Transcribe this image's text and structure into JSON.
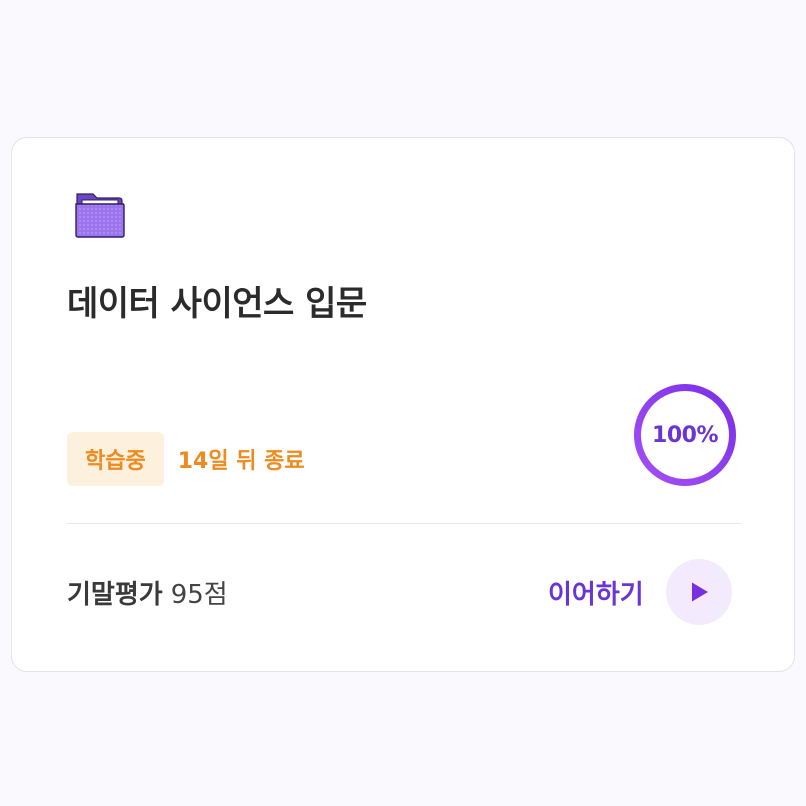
{
  "course": {
    "title": "데이터 사이언스 입문",
    "folder_icon": "folder-icon",
    "status_badge": "학습중",
    "deadline": "14일 뒤 종료",
    "progress": {
      "value": 100,
      "label": "100%"
    },
    "exam": {
      "label": "기말평가",
      "score": "95점"
    },
    "continue_label": "이어하기",
    "play_icon": "play-icon"
  },
  "colors": {
    "accent": "#6a35d4",
    "accent_soft": "#f3eafd",
    "ring": "#8b3ef0",
    "folder": "#8f6ae8",
    "status": "#ef8a1e",
    "status_bg": "#fdf0dc"
  }
}
